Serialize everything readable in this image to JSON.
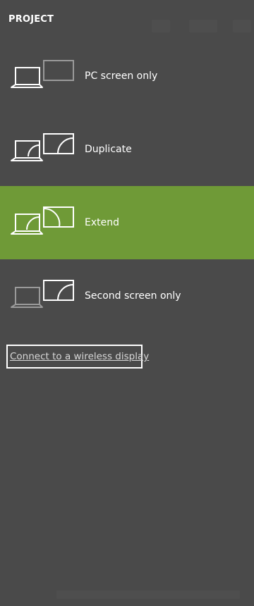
{
  "panel": {
    "title": "PROJECT"
  },
  "options": [
    {
      "label": "PC screen only",
      "icon": "pc-screen-only-icon",
      "selected": false
    },
    {
      "label": "Duplicate",
      "icon": "duplicate-icon",
      "selected": false
    },
    {
      "label": "Extend",
      "icon": "extend-icon",
      "selected": true
    },
    {
      "label": "Second screen only",
      "icon": "second-screen-only-icon",
      "selected": false
    }
  ],
  "wireless_link": {
    "label": "Connect to a wireless display"
  },
  "colors": {
    "background": "#4a4a4a",
    "selected": "#6f9a37",
    "icon_active": "#ffffff",
    "icon_dim": "#9a9a9a"
  }
}
